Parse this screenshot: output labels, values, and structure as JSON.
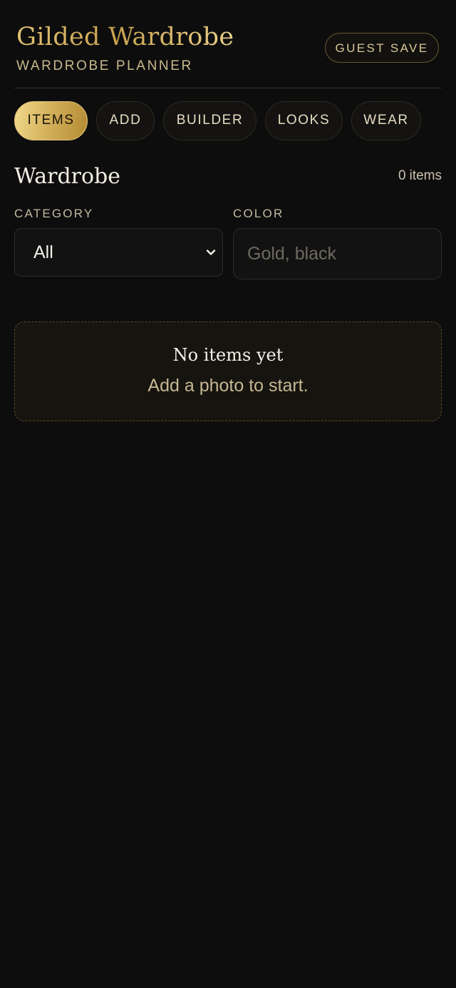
{
  "header": {
    "title": "Gilded Wardrobe",
    "subtitle": "WARDROBE PLANNER",
    "guest_save_label": "GUEST SAVE"
  },
  "tabs": [
    {
      "label": "ITEMS",
      "active": true
    },
    {
      "label": "ADD",
      "active": false
    },
    {
      "label": "BUILDER",
      "active": false
    },
    {
      "label": "LOOKS",
      "active": false
    },
    {
      "label": "WEAR",
      "active": false
    }
  ],
  "section": {
    "title": "Wardrobe",
    "count": "0",
    "count_unit": "items"
  },
  "filters": {
    "category_label": "CATEGORY",
    "category_value": "All",
    "color_label": "COLOR",
    "color_value": "",
    "color_placeholder": "Gold, black"
  },
  "empty_state": {
    "title": "No items yet",
    "message": "Add a photo to start."
  },
  "icons": {
    "category_dropdown": "chevron-down-icon"
  },
  "colors": {
    "background": "#0d0d0d",
    "accent_gold": "#d4b25c",
    "active_tab_text": "#1a1408",
    "muted_text": "#c6b793"
  }
}
